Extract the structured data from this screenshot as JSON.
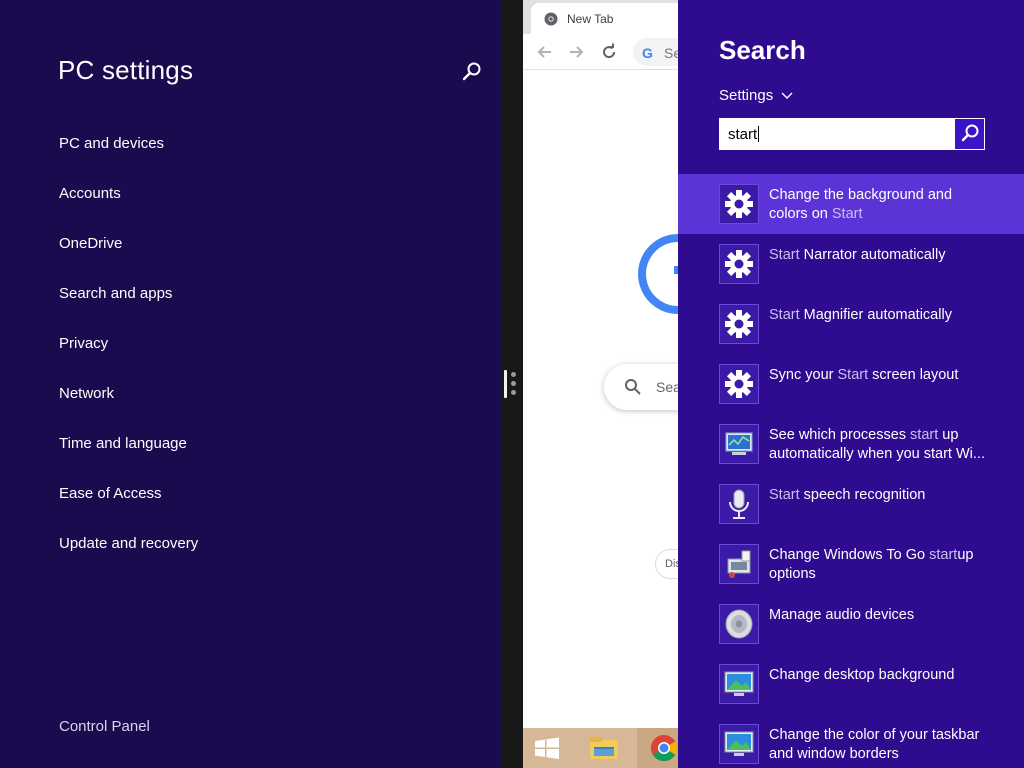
{
  "pc_settings": {
    "title": "PC settings",
    "nav_items": [
      {
        "label": "PC and devices"
      },
      {
        "label": "Accounts"
      },
      {
        "label": "OneDrive"
      },
      {
        "label": "Search and apps"
      },
      {
        "label": "Privacy"
      },
      {
        "label": "Network"
      },
      {
        "label": "Time and language"
      },
      {
        "label": "Ease of Access"
      },
      {
        "label": "Update and recovery"
      }
    ],
    "control_panel_label": "Control Panel"
  },
  "chrome": {
    "tab_title": "New Tab",
    "omnibox_text": "Se",
    "ntp_search_text": "Sea",
    "chip_text": "Dis"
  },
  "search_charm": {
    "title": "Search",
    "scope": "Settings",
    "query": "start",
    "results": [
      {
        "icon": "gear-icon",
        "pre": "Change the background and colors on ",
        "match": "Start",
        "post": ""
      },
      {
        "icon": "gear-icon",
        "pre": "",
        "match": "Start",
        "post": " Narrator automatically"
      },
      {
        "icon": "gear-icon",
        "pre": "",
        "match": "Start",
        "post": " Magnifier automatically"
      },
      {
        "icon": "gear-icon",
        "pre": "Sync your ",
        "match": "Start",
        "post": " screen layout"
      },
      {
        "icon": "task-manager-icon",
        "pre": "See which processes ",
        "match": "start",
        "post": " up automatically when you start Wi..."
      },
      {
        "icon": "microphone-icon",
        "pre": "",
        "match": "Start",
        "post": " speech recognition"
      },
      {
        "icon": "windows-to-go-icon",
        "pre": "Change Windows To Go ",
        "match": "start",
        "post": "up options"
      },
      {
        "icon": "speaker-icon",
        "pre": "Manage audio devices",
        "match": "",
        "post": ""
      },
      {
        "icon": "desktop-background-icon",
        "pre": "Change desktop background",
        "match": "",
        "post": ""
      },
      {
        "icon": "desktop-background-icon",
        "pre": "Change the color of your taskbar and window borders",
        "match": "",
        "post": ""
      }
    ]
  },
  "colors": {
    "settings_bg": "#1a0b4f",
    "charm_bg": "#2e0b8f",
    "selected_result": "#5c33d6",
    "highlight_text": "#c9bff2",
    "taskbar": "#d7b896"
  }
}
